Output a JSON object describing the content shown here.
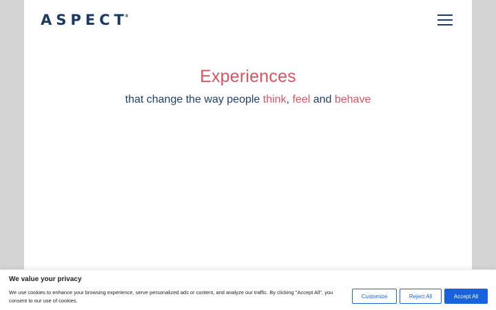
{
  "header": {
    "logo_text": "ASPECT",
    "logo_mark": "®",
    "menu_icon": "hamburger-menu-icon"
  },
  "hero": {
    "title": "Experiences",
    "subtitle_prefix": "that change the way people ",
    "word_think": "think",
    "comma": ", ",
    "word_feel": "feel",
    "and": " and ",
    "word_behave": "behave"
  },
  "cookie_banner": {
    "title": "We value your privacy",
    "text": "We use cookies to enhance your browsing experience, serve personalized ads or content, and analyze our traffic. By clicking \"Accept All\", you consent to our use of cookies.",
    "customize_label": "Customize",
    "reject_label": "Reject All",
    "accept_label": "Accept All"
  },
  "colors": {
    "brand_navy": "#1a3a66",
    "accent_red": "#d85560",
    "button_blue": "#1863dc",
    "background_gray": "#d4d4d4"
  }
}
